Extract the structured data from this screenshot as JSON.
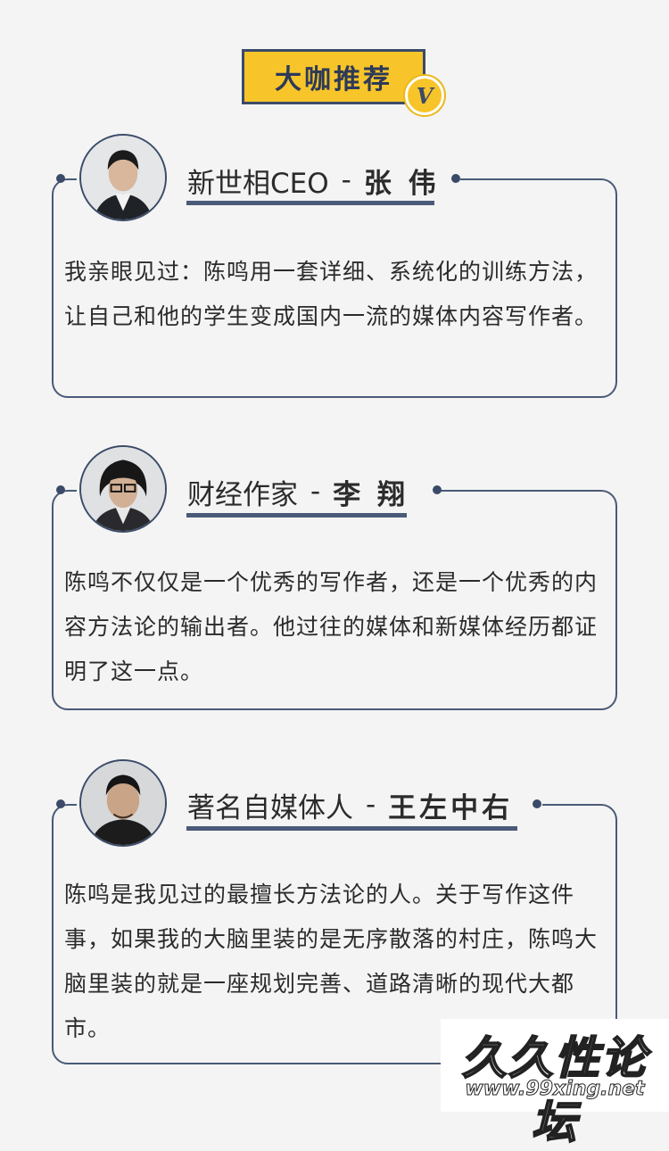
{
  "header": {
    "title": "大咖推荐",
    "badge": "V"
  },
  "cards": [
    {
      "role": "新世相CEO",
      "separator": "-",
      "name": "张 伟",
      "quote": "我亲眼见过：陈鸣用一套详细、系统化的训练方法，让自己和他的学生变成国内一流的媒体内容写作者。"
    },
    {
      "role": "财经作家",
      "separator": "-",
      "name": "李 翔",
      "quote": "陈鸣不仅仅是一个优秀的写作者，还是一个优秀的内容方法论的输出者。他过往的媒体和新媒体经历都证明了这一点。"
    },
    {
      "role": "著名自媒体人",
      "separator": "-",
      "name": "王左中右",
      "quote": "陈鸣是我见过的最擅长方法论的人。关于写作这件事，如果我的大脑里装的是无序散落的村庄，陈鸣大脑里装的就是一座规划完善、道路清晰的现代大都市。"
    }
  ],
  "watermark": {
    "title": "久久性论坛",
    "url": "www.99xing.net"
  },
  "colors": {
    "accent_yellow": "#f7c52a",
    "navy": "#3a4a68",
    "background": "#f3f4f3"
  }
}
